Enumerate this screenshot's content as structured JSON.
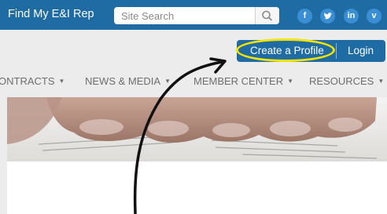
{
  "topbar": {
    "rep_link": "Find My E&I Rep",
    "search_placeholder": "Site Search",
    "social": [
      {
        "icon": "facebook-icon",
        "glyph": "f"
      },
      {
        "icon": "twitter-icon",
        "glyph": "t"
      },
      {
        "icon": "linkedin-icon",
        "glyph": "in"
      },
      {
        "icon": "vimeo-icon",
        "glyph": "v"
      }
    ]
  },
  "account": {
    "create_profile_label": "Create a Profile",
    "login_label": "Login"
  },
  "nav": {
    "items": [
      {
        "label": "ONTRACTS"
      },
      {
        "label": "NEWS & MEDIA"
      },
      {
        "label": "MEMBER CENTER"
      },
      {
        "label": "RESOURCES"
      }
    ]
  },
  "colors": {
    "brand_blue": "#1f6ba3",
    "highlight_yellow": "#f2e300",
    "annotation_arrow": "#111111"
  }
}
